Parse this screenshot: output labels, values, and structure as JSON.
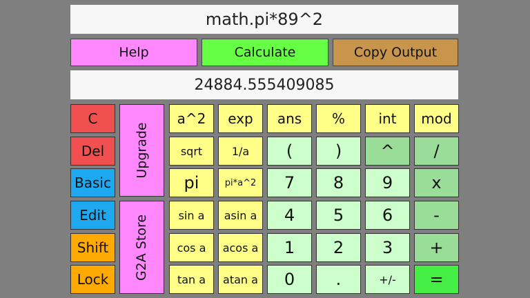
{
  "expression": "math.pi*89^2",
  "output": "24884.555409085",
  "top_buttons": {
    "help": "Help",
    "calculate": "Calculate",
    "copy_output": "Copy Output"
  },
  "side_buttons": [
    "C",
    "Del",
    "Basic",
    "Edit",
    "Shift",
    "Lock"
  ],
  "tall_buttons": {
    "upgrade": "Upgrade",
    "store": "G2A Store"
  },
  "function_keys": [
    [
      "a^2",
      "exp"
    ],
    [
      "sqrt",
      "1/a"
    ],
    [
      "pi",
      "pi*a^2"
    ],
    [
      "sin a",
      "asin a"
    ],
    [
      "cos a",
      "acos a"
    ],
    [
      "tan a",
      "atan a"
    ]
  ],
  "grid_keys": [
    [
      "ans",
      "%",
      "int",
      "mod"
    ],
    [
      "(",
      ")",
      "^",
      "/"
    ],
    [
      "7",
      "8",
      "9",
      "x"
    ],
    [
      "4",
      "5",
      "6",
      "-"
    ],
    [
      "1",
      "2",
      "3",
      "+"
    ],
    [
      "0",
      ".",
      "+/-",
      "="
    ]
  ],
  "colors": {
    "background": "#7f7f7f",
    "red": "#f05050",
    "blue": "#1ea8f0",
    "orange": "#ffaa00",
    "magenta": "#ff88ff",
    "yellow": "#ffff88",
    "light_green": "#ccffcc",
    "mid_green": "#99dd99",
    "bright_green": "#44ee44"
  }
}
